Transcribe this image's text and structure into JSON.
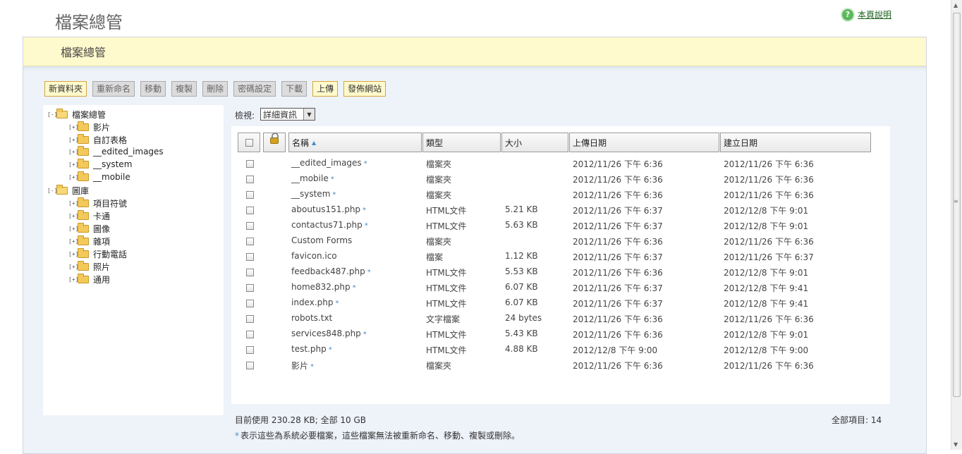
{
  "page_title": "檔案總管",
  "help_link": "本頁說明",
  "subheader_title": "檔案總管",
  "toolbar": {
    "new_folder": "新資料夾",
    "rename": "重新命名",
    "move": "移動",
    "copy": "複製",
    "delete": "刪除",
    "password": "密碼設定",
    "download": "下載",
    "upload": "上傳",
    "publish": "發佈網站"
  },
  "tree": {
    "root": "檔案總管",
    "root_children": [
      "影片",
      "自訂表格",
      "__edited_images",
      "__system",
      "__mobile"
    ],
    "gallery": "圖庫",
    "gallery_children": [
      "項目符號",
      "卡通",
      "圖像",
      "雜項",
      "行動電話",
      "照片",
      "通用"
    ]
  },
  "view": {
    "label": "檢視:",
    "selected": "詳細資訊"
  },
  "table": {
    "headers": {
      "name": "名稱",
      "type": "類型",
      "size": "大小",
      "uploaded": "上傳日期",
      "created": "建立日期"
    },
    "rows": [
      {
        "name": "__edited_images",
        "star": "*",
        "type": "檔案夾",
        "size": "",
        "uploaded": "2012/11/26 下午 6:36",
        "created": "2012/11/26 下午 6:36"
      },
      {
        "name": "__mobile",
        "star": "*",
        "type": "檔案夾",
        "size": "",
        "uploaded": "2012/11/26 下午 6:36",
        "created": "2012/11/26 下午 6:36"
      },
      {
        "name": "__system",
        "star": "*",
        "type": "檔案夾",
        "size": "",
        "uploaded": "2012/11/26 下午 6:36",
        "created": "2012/11/26 下午 6:36"
      },
      {
        "name": "aboutus151.php",
        "star": "*",
        "type": "HTML文件",
        "size": "5.21 KB",
        "uploaded": "2012/11/26 下午 6:37",
        "created": "2012/12/8 下午 9:01"
      },
      {
        "name": "contactus71.php",
        "star": "*",
        "type": "HTML文件",
        "size": "5.63 KB",
        "uploaded": "2012/11/26 下午 6:37",
        "created": "2012/12/8 下午 9:01"
      },
      {
        "name": "Custom Forms",
        "star": "",
        "type": "檔案夾",
        "size": "",
        "uploaded": "2012/11/26 下午 6:36",
        "created": "2012/11/26 下午 6:36"
      },
      {
        "name": "favicon.ico",
        "star": "",
        "type": "檔案",
        "size": "1.12 KB",
        "uploaded": "2012/11/26 下午 6:37",
        "created": "2012/11/26 下午 6:37"
      },
      {
        "name": "feedback487.php",
        "star": "*",
        "type": "HTML文件",
        "size": "5.53 KB",
        "uploaded": "2012/11/26 下午 6:36",
        "created": "2012/12/8 下午 9:01"
      },
      {
        "name": "home832.php",
        "star": "*",
        "type": "HTML文件",
        "size": "6.07 KB",
        "uploaded": "2012/11/26 下午 6:37",
        "created": "2012/12/8 下午 9:41"
      },
      {
        "name": "index.php",
        "star": "*",
        "type": "HTML文件",
        "size": "6.07 KB",
        "uploaded": "2012/11/26 下午 6:37",
        "created": "2012/12/8 下午 9:41"
      },
      {
        "name": "robots.txt",
        "star": "",
        "type": "文字檔案",
        "size": "24 bytes",
        "uploaded": "2012/11/26 下午 6:36",
        "created": "2012/11/26 下午 6:36"
      },
      {
        "name": "services848.php",
        "star": "*",
        "type": "HTML文件",
        "size": "5.43 KB",
        "uploaded": "2012/11/26 下午 6:36",
        "created": "2012/12/8 下午 9:01"
      },
      {
        "name": "test.php",
        "star": "*",
        "type": "HTML文件",
        "size": "4.88 KB",
        "uploaded": "2012/12/8 下午 9:00",
        "created": "2012/12/8 下午 9:00"
      },
      {
        "name": "影片",
        "star": "*",
        "type": "檔案夾",
        "size": "",
        "uploaded": "2012/11/26 下午 6:36",
        "created": "2012/11/26 下午 6:36"
      }
    ]
  },
  "footer": {
    "usage": "目前使用 230.28 KB; 全部 10 GB",
    "total_items": "全部項目: 14",
    "note_star": "*",
    "note": "表示這些為系統必要檔案，這些檔案無法被重新命名、移動、複製或刪除。"
  },
  "colors": {
    "subheader_bg": "#fffacd",
    "panel_bg": "#eef2f9",
    "accent_star": "#4a8ac8"
  },
  "icons": {
    "help": "question-circle-icon",
    "folder": "folder-icon",
    "lock": "lock-icon",
    "sort": "sort-ascending-icon"
  }
}
